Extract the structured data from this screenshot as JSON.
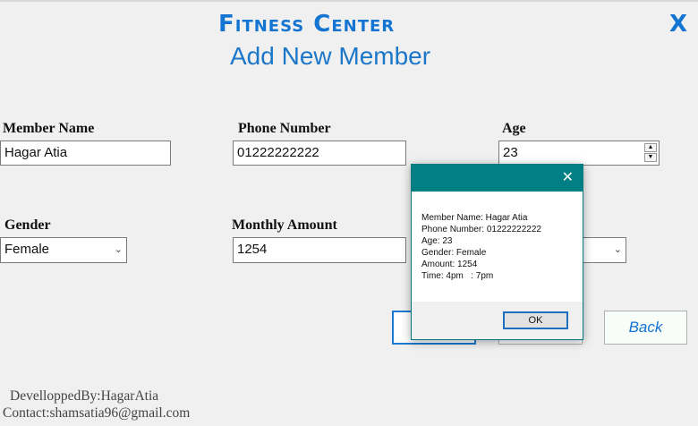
{
  "header": {
    "app_title": "Fitness Center",
    "page_title": "Add New Member",
    "close_label": "X"
  },
  "form": {
    "member_name": {
      "label": "Member Name",
      "value": "Hagar Atia"
    },
    "phone_number": {
      "label": "Phone Number",
      "value": "01222222222"
    },
    "age": {
      "label": "Age",
      "value": "23"
    },
    "gender": {
      "label": "Gender",
      "value": "Female"
    },
    "monthly_amount": {
      "label": "Monthly Amount",
      "value": "1254"
    },
    "time_value": ""
  },
  "buttons": {
    "back_label": "Back"
  },
  "footer": {
    "developed_by": "DevelloppedBy:HagarAtia",
    "contact": "Contact:shamsatia96@gmail.com"
  },
  "dialog": {
    "close_label": "✕",
    "lines": [
      "Member Name: Hagar Atia",
      "Phone Number: 01222222222",
      "Age: 23",
      "Gender: Female",
      "Amount: 1254",
      "Time: 4pm   : 7pm"
    ],
    "ok_label": "OK"
  },
  "colors": {
    "accent": "#1474d1",
    "dialog_titlebar": "#007f84"
  }
}
